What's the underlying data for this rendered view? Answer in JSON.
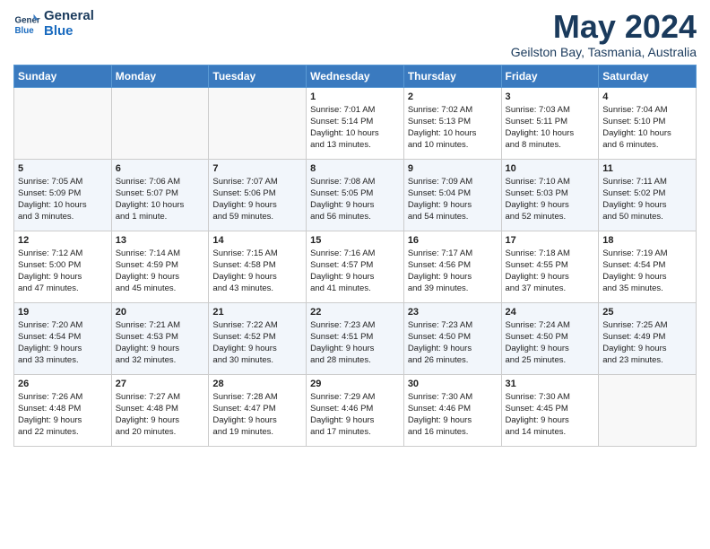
{
  "header": {
    "logo_line1": "General",
    "logo_line2": "Blue",
    "month": "May 2024",
    "location": "Geilston Bay, Tasmania, Australia"
  },
  "weekdays": [
    "Sunday",
    "Monday",
    "Tuesday",
    "Wednesday",
    "Thursday",
    "Friday",
    "Saturday"
  ],
  "weeks": [
    [
      {
        "day": "",
        "info": ""
      },
      {
        "day": "",
        "info": ""
      },
      {
        "day": "",
        "info": ""
      },
      {
        "day": "1",
        "info": "Sunrise: 7:01 AM\nSunset: 5:14 PM\nDaylight: 10 hours\nand 13 minutes."
      },
      {
        "day": "2",
        "info": "Sunrise: 7:02 AM\nSunset: 5:13 PM\nDaylight: 10 hours\nand 10 minutes."
      },
      {
        "day": "3",
        "info": "Sunrise: 7:03 AM\nSunset: 5:11 PM\nDaylight: 10 hours\nand 8 minutes."
      },
      {
        "day": "4",
        "info": "Sunrise: 7:04 AM\nSunset: 5:10 PM\nDaylight: 10 hours\nand 6 minutes."
      }
    ],
    [
      {
        "day": "5",
        "info": "Sunrise: 7:05 AM\nSunset: 5:09 PM\nDaylight: 10 hours\nand 3 minutes."
      },
      {
        "day": "6",
        "info": "Sunrise: 7:06 AM\nSunset: 5:07 PM\nDaylight: 10 hours\nand 1 minute."
      },
      {
        "day": "7",
        "info": "Sunrise: 7:07 AM\nSunset: 5:06 PM\nDaylight: 9 hours\nand 59 minutes."
      },
      {
        "day": "8",
        "info": "Sunrise: 7:08 AM\nSunset: 5:05 PM\nDaylight: 9 hours\nand 56 minutes."
      },
      {
        "day": "9",
        "info": "Sunrise: 7:09 AM\nSunset: 5:04 PM\nDaylight: 9 hours\nand 54 minutes."
      },
      {
        "day": "10",
        "info": "Sunrise: 7:10 AM\nSunset: 5:03 PM\nDaylight: 9 hours\nand 52 minutes."
      },
      {
        "day": "11",
        "info": "Sunrise: 7:11 AM\nSunset: 5:02 PM\nDaylight: 9 hours\nand 50 minutes."
      }
    ],
    [
      {
        "day": "12",
        "info": "Sunrise: 7:12 AM\nSunset: 5:00 PM\nDaylight: 9 hours\nand 47 minutes."
      },
      {
        "day": "13",
        "info": "Sunrise: 7:14 AM\nSunset: 4:59 PM\nDaylight: 9 hours\nand 45 minutes."
      },
      {
        "day": "14",
        "info": "Sunrise: 7:15 AM\nSunset: 4:58 PM\nDaylight: 9 hours\nand 43 minutes."
      },
      {
        "day": "15",
        "info": "Sunrise: 7:16 AM\nSunset: 4:57 PM\nDaylight: 9 hours\nand 41 minutes."
      },
      {
        "day": "16",
        "info": "Sunrise: 7:17 AM\nSunset: 4:56 PM\nDaylight: 9 hours\nand 39 minutes."
      },
      {
        "day": "17",
        "info": "Sunrise: 7:18 AM\nSunset: 4:55 PM\nDaylight: 9 hours\nand 37 minutes."
      },
      {
        "day": "18",
        "info": "Sunrise: 7:19 AM\nSunset: 4:54 PM\nDaylight: 9 hours\nand 35 minutes."
      }
    ],
    [
      {
        "day": "19",
        "info": "Sunrise: 7:20 AM\nSunset: 4:54 PM\nDaylight: 9 hours\nand 33 minutes."
      },
      {
        "day": "20",
        "info": "Sunrise: 7:21 AM\nSunset: 4:53 PM\nDaylight: 9 hours\nand 32 minutes."
      },
      {
        "day": "21",
        "info": "Sunrise: 7:22 AM\nSunset: 4:52 PM\nDaylight: 9 hours\nand 30 minutes."
      },
      {
        "day": "22",
        "info": "Sunrise: 7:23 AM\nSunset: 4:51 PM\nDaylight: 9 hours\nand 28 minutes."
      },
      {
        "day": "23",
        "info": "Sunrise: 7:23 AM\nSunset: 4:50 PM\nDaylight: 9 hours\nand 26 minutes."
      },
      {
        "day": "24",
        "info": "Sunrise: 7:24 AM\nSunset: 4:50 PM\nDaylight: 9 hours\nand 25 minutes."
      },
      {
        "day": "25",
        "info": "Sunrise: 7:25 AM\nSunset: 4:49 PM\nDaylight: 9 hours\nand 23 minutes."
      }
    ],
    [
      {
        "day": "26",
        "info": "Sunrise: 7:26 AM\nSunset: 4:48 PM\nDaylight: 9 hours\nand 22 minutes."
      },
      {
        "day": "27",
        "info": "Sunrise: 7:27 AM\nSunset: 4:48 PM\nDaylight: 9 hours\nand 20 minutes."
      },
      {
        "day": "28",
        "info": "Sunrise: 7:28 AM\nSunset: 4:47 PM\nDaylight: 9 hours\nand 19 minutes."
      },
      {
        "day": "29",
        "info": "Sunrise: 7:29 AM\nSunset: 4:46 PM\nDaylight: 9 hours\nand 17 minutes."
      },
      {
        "day": "30",
        "info": "Sunrise: 7:30 AM\nSunset: 4:46 PM\nDaylight: 9 hours\nand 16 minutes."
      },
      {
        "day": "31",
        "info": "Sunrise: 7:30 AM\nSunset: 4:45 PM\nDaylight: 9 hours\nand 14 minutes."
      },
      {
        "day": "",
        "info": ""
      }
    ]
  ]
}
